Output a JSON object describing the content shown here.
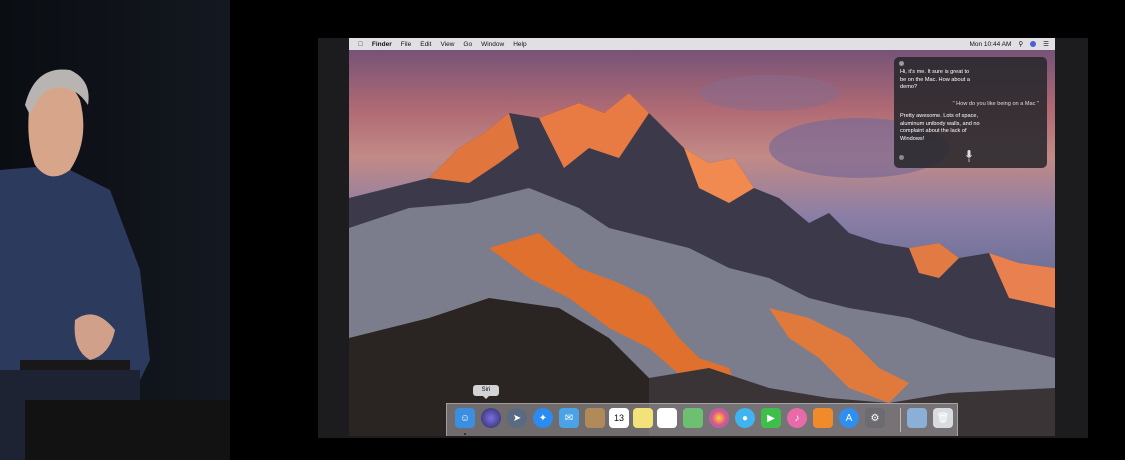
{
  "menubar": {
    "apple_icon": "apple-icon",
    "app_name": "Finder",
    "menus": [
      "File",
      "Edit",
      "View",
      "Go",
      "Window",
      "Help"
    ],
    "clock": "Mon 10:44 AM"
  },
  "siri": {
    "message1": "Hi, it's me. It sure is great to be on the Mac. How about a demo?",
    "user_query": "\" How do you like being on a Mac \"",
    "message2": "Pretty awesome. Lots of space, aluminum unibody walls, and no complaint about the lack of Windows!"
  },
  "dock": {
    "tooltip": "Siri",
    "calendar_day": "13",
    "apps": [
      "finder",
      "siri",
      "launchpad",
      "safari",
      "mail",
      "contacts",
      "calendar",
      "notes",
      "reminders",
      "maps",
      "photos",
      "messages",
      "facetime",
      "itunes",
      "ibooks",
      "app-store",
      "system-preferences",
      "preview",
      "trash"
    ],
    "colors": {
      "finder": "#3b8fe0",
      "siri": "#4a3fa0",
      "launchpad": "#5a6a80",
      "safari": "#2a8cf0",
      "mail": "#4aa3e6",
      "contacts": "#b08a58",
      "calendar": "#ffffff",
      "notes": "#f3e27a",
      "reminders": "#ffffff",
      "maps": "#6cc070",
      "photos": "#f0f0f0",
      "messages": "#3fb4f0",
      "facetime": "#3dbf4a",
      "itunes": "#e86aa8",
      "ibooks": "#f08a2a",
      "app-store": "#2f8ff0",
      "system-preferences": "#6c6c70",
      "preview": "#8ab0d8",
      "trash": "#d8dce0"
    }
  }
}
